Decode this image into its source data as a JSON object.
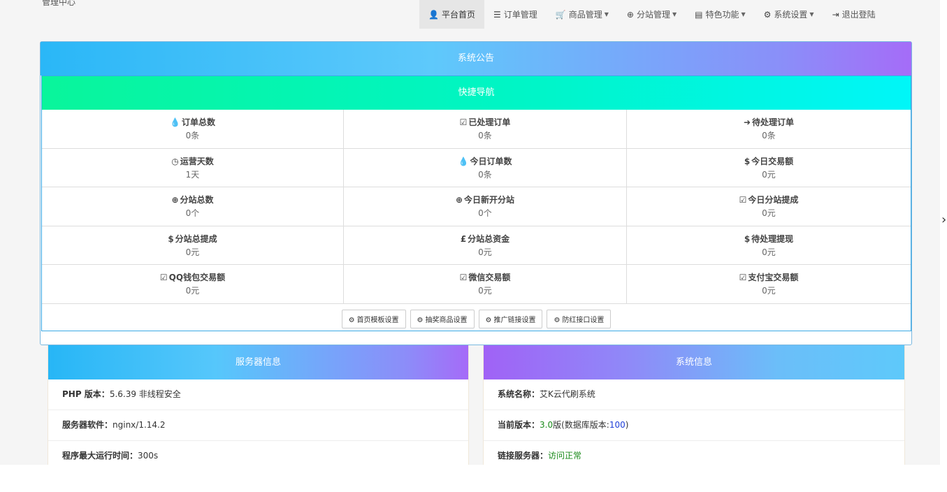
{
  "brand": "管理中心",
  "nav": {
    "items": [
      {
        "icon": "👤",
        "label": "平台首页",
        "caret": false
      },
      {
        "icon": "☰",
        "label": "订单管理",
        "caret": false
      },
      {
        "icon": "🛒",
        "label": "商品管理",
        "caret": true
      },
      {
        "icon": "⊕",
        "label": "分站管理",
        "caret": true
      },
      {
        "icon": "▤",
        "label": "特色功能",
        "caret": true
      },
      {
        "icon": "⚙",
        "label": "系统设置",
        "caret": true
      },
      {
        "icon": "⇥",
        "label": "退出登陆",
        "caret": false
      }
    ]
  },
  "notice": {
    "title": "系统公告"
  },
  "quick": {
    "title": "快捷导航",
    "stats": [
      [
        {
          "icon": "💧",
          "label": "订单总数",
          "value": "0条"
        },
        {
          "icon": "☑",
          "label": "已处理订单",
          "value": "0条"
        },
        {
          "icon": "➜",
          "label": "待处理订单",
          "value": "0条"
        }
      ],
      [
        {
          "icon": "◷",
          "label": "运营天数",
          "value": "1天"
        },
        {
          "icon": "💧",
          "label": "今日订单数",
          "value": "0条"
        },
        {
          "icon": "$",
          "label": "今日交易额",
          "value": "0元"
        }
      ],
      [
        {
          "icon": "⊕",
          "label": "分站总数",
          "value": "0个"
        },
        {
          "icon": "⊕",
          "label": "今日新开分站",
          "value": "0个"
        },
        {
          "icon": "☑",
          "label": "今日分站提成",
          "value": "0元"
        }
      ],
      [
        {
          "icon": "$",
          "label": "分站总提成",
          "value": "0元"
        },
        {
          "icon": "£",
          "label": "分站总资金",
          "value": "0元"
        },
        {
          "icon": "$",
          "label": "待处理提现",
          "value": "0元"
        }
      ],
      [
        {
          "icon": "☑",
          "label": "QQ钱包交易额",
          "value": "0元"
        },
        {
          "icon": "☑",
          "label": "微信交易额",
          "value": "0元"
        },
        {
          "icon": "☑",
          "label": "支付宝交易额",
          "value": "0元"
        }
      ]
    ],
    "buttons": [
      {
        "icon": "⚙",
        "label": "首页模板设置"
      },
      {
        "icon": "⚙",
        "label": "抽奖商品设置"
      },
      {
        "icon": "⚙",
        "label": "推广链接设置"
      },
      {
        "icon": "⚙",
        "label": "防红接口设置"
      }
    ]
  },
  "server_info": {
    "title": "服务器信息",
    "rows": [
      {
        "label": "PHP 版本：",
        "value": "5.6.39 非线程安全"
      },
      {
        "label": "服务器软件：",
        "value": "nginx/1.14.2"
      },
      {
        "label": "程序最大运行时间：",
        "value": "300s"
      }
    ]
  },
  "system_info": {
    "title": "系统信息",
    "name_label": "系统名称：",
    "name_value": "艾K云代刷系统",
    "version_label": "当前版本：",
    "version_value": "3.0",
    "version_suffix": "版(数据库版本:",
    "db_version": "100",
    "version_close": ")",
    "link_label": "链接服务器：",
    "link_value": "访问正常"
  },
  "side_arrow": "›"
}
